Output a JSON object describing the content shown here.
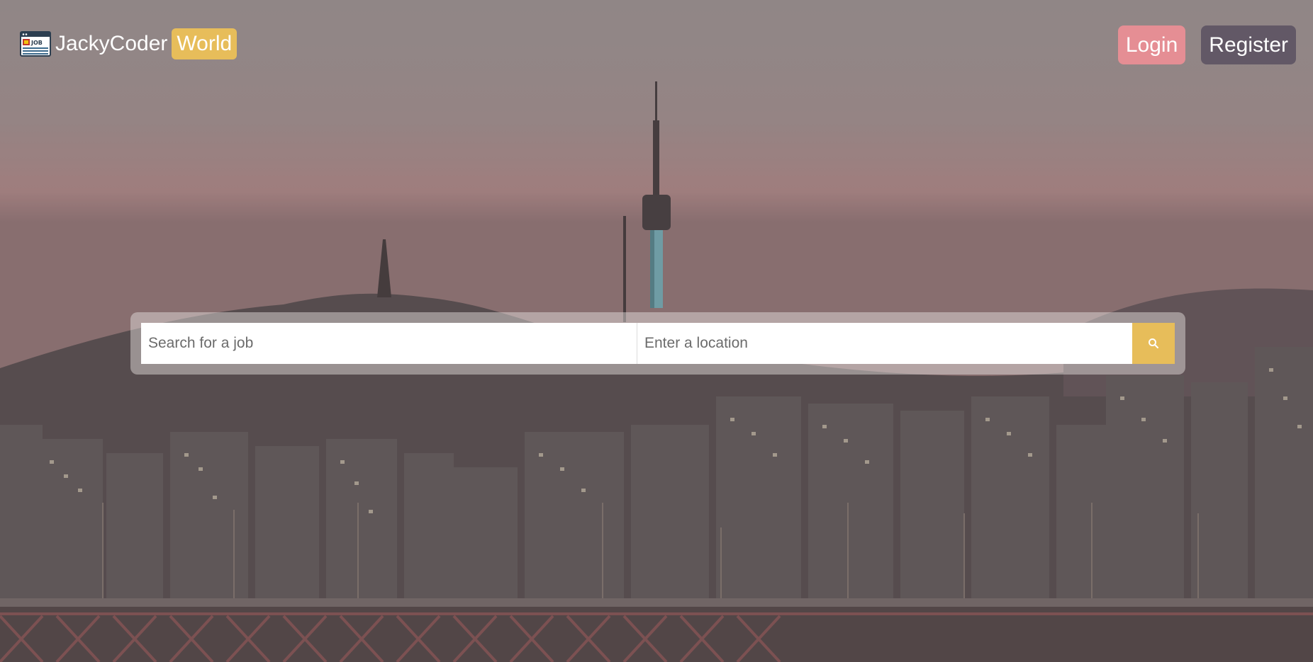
{
  "brand": {
    "name": "JackyCoder",
    "badge": "World",
    "logo_icon": "job-board-icon"
  },
  "nav": {
    "login_label": "Login",
    "register_label": "Register"
  },
  "search": {
    "job_placeholder": "Search for a job",
    "job_value": "",
    "location_placeholder": "Enter a location",
    "location_value": "",
    "button_icon": "search-icon"
  },
  "colors": {
    "accent": "#e7bd5a",
    "login_button": "#e58e94",
    "register_button": "#625866"
  }
}
